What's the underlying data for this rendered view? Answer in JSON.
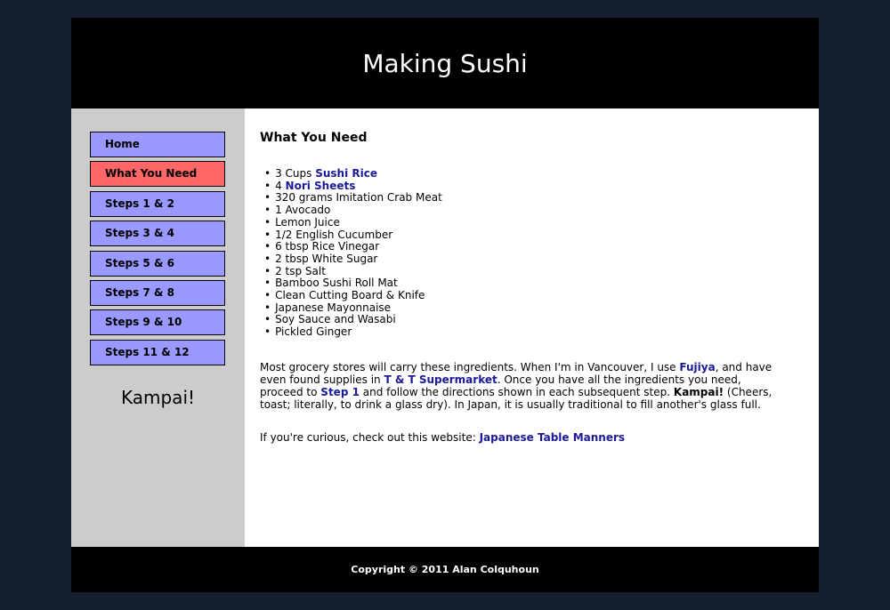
{
  "header": {
    "title": "Making Sushi"
  },
  "nav": {
    "items": [
      {
        "label": "Home"
      },
      {
        "label": "What You Need"
      },
      {
        "label": "Steps 1 & 2"
      },
      {
        "label": "Steps 3 & 4"
      },
      {
        "label": "Steps 5 & 6"
      },
      {
        "label": "Steps 7 & 8"
      },
      {
        "label": "Steps 9 & 10"
      },
      {
        "label": "Steps 11 & 12"
      }
    ],
    "active_color": "#ff6666",
    "item_color": "#9999ff"
  },
  "sidebar": {
    "tagline": "Kampai!"
  },
  "content": {
    "heading": "What You Need",
    "ingredients": [
      {
        "prefix": "3 Cups ",
        "link": "Sushi Rice"
      },
      {
        "prefix": "4 ",
        "link": "Nori Sheets"
      },
      {
        "text": "320 grams Imitation Crab Meat"
      },
      {
        "text": "1 Avocado"
      },
      {
        "text": "Lemon Juice"
      },
      {
        "text": "1/2 English Cucumber"
      },
      {
        "text": "6 tbsp Rice Vinegar"
      },
      {
        "text": "2 tbsp White Sugar"
      },
      {
        "text": "2 tsp Salt"
      },
      {
        "text": "Bamboo Sushi Roll Mat"
      },
      {
        "text": "Clean Cutting Board & Knife"
      },
      {
        "text": "Japanese Mayonnaise"
      },
      {
        "text": "Soy Sauce and Wasabi"
      },
      {
        "text": "Pickled Ginger"
      }
    ],
    "para1": {
      "t1": "Most grocery stores will carry these ingredients. When I'm in Vancouver, I use ",
      "link1": "Fujiya",
      "t2": ", and have even found supplies in ",
      "link2": "T & T Supermarket",
      "t3": ". Once you have all the ingredients you need, proceed to ",
      "link3": "Step 1",
      "t4": " and follow the directions shown in each subsequent step. ",
      "bold": "Kampai!",
      "t5": " (Cheers, toast; literally, to drink a glass dry). In Japan, it is usually traditional to fill another's glass full."
    },
    "para2": {
      "text": "If you're curious, check out this website: ",
      "link": "Japanese Table Manners"
    }
  },
  "footer": {
    "copyright": "Copyright © 2011 Alan Colquhoun"
  }
}
